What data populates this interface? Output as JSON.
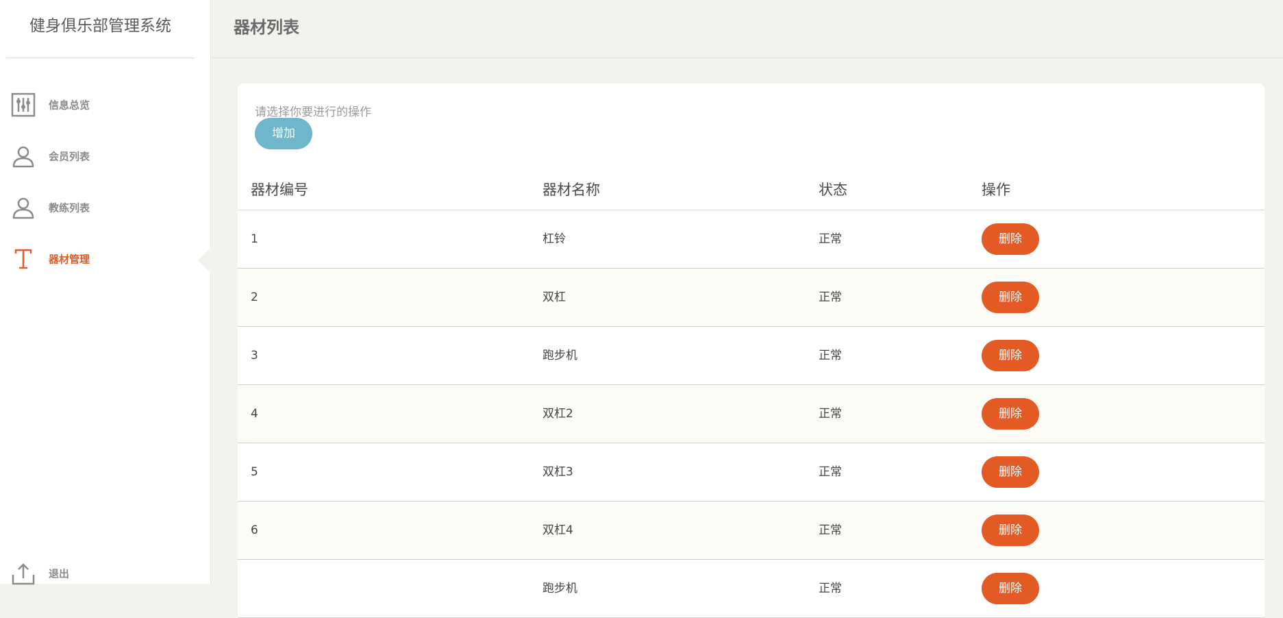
{
  "app": {
    "title": "健身俱乐部管理系统"
  },
  "sidebar": {
    "items": [
      {
        "label": "信息总览",
        "icon": "sliders-icon",
        "active": false
      },
      {
        "label": "会员列表",
        "icon": "user-icon",
        "active": false
      },
      {
        "label": "教练列表",
        "icon": "user-icon",
        "active": false
      },
      {
        "label": "器材管理",
        "icon": "text-t-icon",
        "active": true
      }
    ],
    "logout": {
      "label": "退出",
      "icon": "upload-icon"
    }
  },
  "header": {
    "title": "器材列表"
  },
  "toolbar": {
    "hint": "请选择你要进行的操作",
    "add_label": "增加"
  },
  "table": {
    "columns": [
      "器材编号",
      "器材名称",
      "状态",
      "操作"
    ],
    "rows": [
      {
        "id": "1",
        "name": "杠铃",
        "status": "正常",
        "action": "删除"
      },
      {
        "id": "2",
        "name": "双杠",
        "status": "正常",
        "action": "删除"
      },
      {
        "id": "3",
        "name": "跑步机",
        "status": "正常",
        "action": "删除"
      },
      {
        "id": "4",
        "name": "双杠2",
        "status": "正常",
        "action": "删除"
      },
      {
        "id": "5",
        "name": "双杠3",
        "status": "正常",
        "action": "删除"
      },
      {
        "id": "6",
        "name": "双杠4",
        "status": "正常",
        "action": "删除"
      },
      {
        "id": "",
        "name": "跑步机",
        "status": "正常",
        "action": "删除"
      }
    ]
  },
  "colors": {
    "accent": "#e35a25",
    "add_button": "#6eb6cc",
    "icon_gray": "#8a8a8a"
  }
}
